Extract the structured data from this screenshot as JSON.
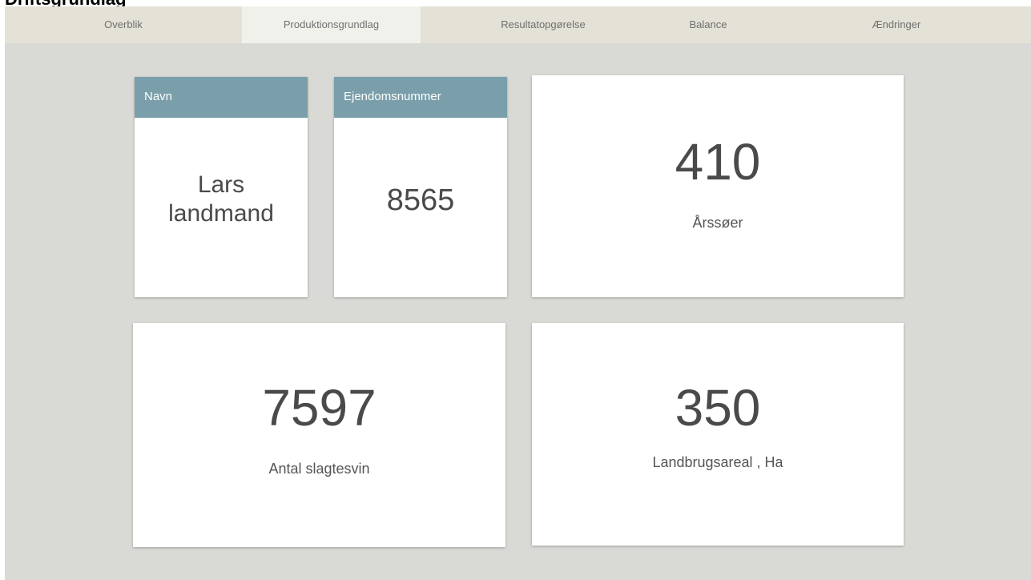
{
  "header": {
    "title": "Driftsgrundlag"
  },
  "tabs": [
    {
      "label": "Overblik"
    },
    {
      "label": "Produktionsgrundlag"
    },
    {
      "label": "Resultatopgørelse"
    },
    {
      "label": "Balance"
    },
    {
      "label": "Ændringer"
    }
  ],
  "active_tab": "Produktionsgrundlag",
  "cards": {
    "name": {
      "header": "Navn",
      "line1": "Lars",
      "line2": "landmand"
    },
    "property": {
      "header": "Ejendomsnummer",
      "value": "8565"
    },
    "sows": {
      "value": "410",
      "label": "Årssøer"
    },
    "pigs": {
      "value": "7597",
      "label": "Antal slagtesvin"
    },
    "area": {
      "value": "350",
      "label": "Landbrugsareal , Ha"
    }
  },
  "colors": {
    "background": "#d9dad5",
    "tabbar": "#e4e1d6",
    "active_tab": "#f1f1ec",
    "card_header": "#7a9faa"
  }
}
